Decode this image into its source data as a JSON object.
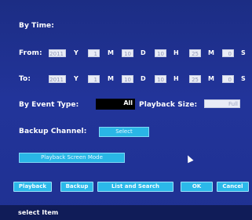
{
  "by_time_label": "By Time:",
  "from": {
    "label": "From:",
    "year": "2011",
    "year_unit": "Y",
    "month": "1",
    "month_unit": "M",
    "day": "10",
    "day_unit": "D",
    "hour": "10",
    "hour_unit": "H",
    "minute": "25",
    "minute_unit": "M",
    "second": "0",
    "second_unit": "S"
  },
  "to": {
    "label": "To:",
    "year": "2011",
    "year_unit": "Y",
    "month": "1",
    "month_unit": "M",
    "day": "10",
    "day_unit": "D",
    "hour": "10",
    "hour_unit": "H",
    "minute": "25",
    "minute_unit": "M",
    "second": "0",
    "second_unit": "S"
  },
  "event_type": {
    "label": "By Event Type:",
    "value": "All"
  },
  "playback_size": {
    "label": "Playback Size:",
    "value": "Full"
  },
  "backup_channel": {
    "label": "Backup Channel:",
    "button": "Select"
  },
  "playback_screen_mode": "Playback Screen Mode",
  "buttons": {
    "playback": "Playback",
    "backup": "Backup",
    "list_and_search": "List and Search",
    "ok": "OK",
    "cancel": "Cancel"
  },
  "status_text": "select Item",
  "colors": {
    "background": "#22349a",
    "button": "#2bb9ea",
    "field": "#e9ecf6",
    "status_bar": "#101c58"
  }
}
